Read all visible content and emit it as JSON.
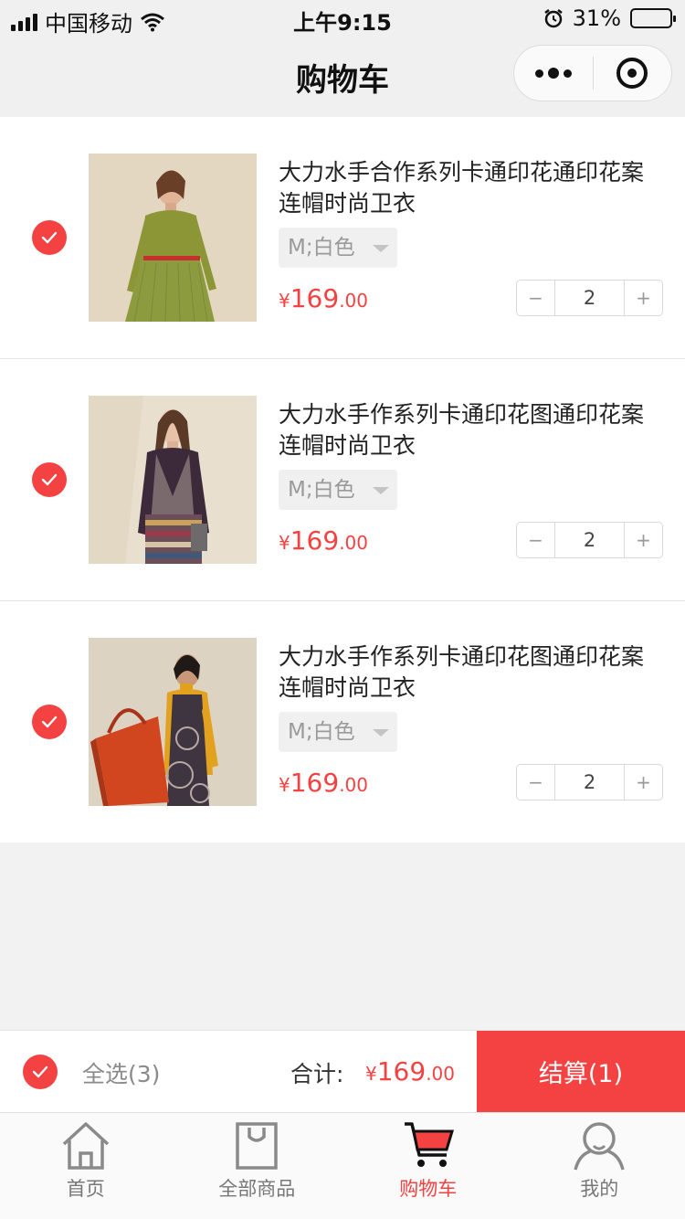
{
  "status_bar": {
    "carrier": "中国移动",
    "time": "上午9:15",
    "battery": "31%",
    "battery_level": 0.31
  },
  "nav": {
    "title": "购物车"
  },
  "cart": {
    "items": [
      {
        "title": "大力水手合作系列卡通印花通印花案连帽时尚卫衣",
        "spec": "M;白色",
        "currency": "¥",
        "price_int": "169",
        "price_dec": ".00",
        "qty": "2",
        "checked": true,
        "minus": "−",
        "plus": "+"
      },
      {
        "title": "大力水手作系列卡通印花图通印花案连帽时尚卫衣",
        "spec": "M;白色",
        "currency": "¥",
        "price_int": "169",
        "price_dec": ".00",
        "qty": "2",
        "checked": true,
        "minus": "−",
        "plus": "+"
      },
      {
        "title": "大力水手作系列卡通印花图通印花案连帽时尚卫衣",
        "spec": "M;白色",
        "currency": "¥",
        "price_int": "169",
        "price_dec": ".00",
        "qty": "2",
        "checked": true,
        "minus": "−",
        "plus": "+"
      }
    ]
  },
  "checkout": {
    "select_all": "全选(3)",
    "total_label": "合计:",
    "currency": "¥",
    "total_int": "169",
    "total_dec": ".00",
    "pay_button": "结算(1)"
  },
  "tabbar": {
    "tabs": [
      {
        "label": "首页",
        "icon": "home-icon"
      },
      {
        "label": "全部商品",
        "icon": "shopping-bag-icon"
      },
      {
        "label": "购物车",
        "icon": "cart-icon",
        "active": true
      },
      {
        "label": "我的",
        "icon": "user-icon"
      }
    ]
  },
  "colors": {
    "accent": "#f44242",
    "active_tab": "#f44242"
  }
}
